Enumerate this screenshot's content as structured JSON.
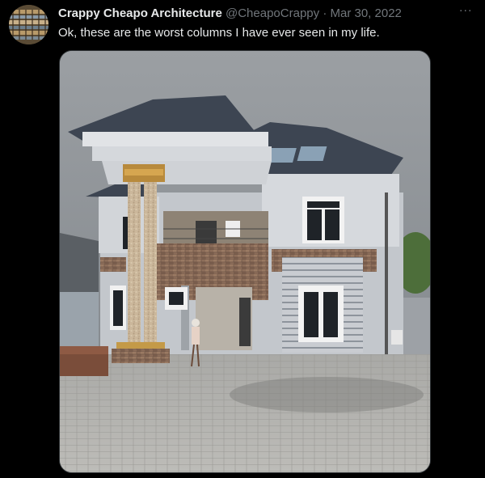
{
  "tweet": {
    "author_name": "Crappy Cheapo Architecture",
    "handle": "@CheapoCrappy",
    "separator": "·",
    "date": "Mar 30, 2022",
    "text": "Ok, these are the worst columns I have ever seen in my life.",
    "more_icon_text": "···"
  },
  "colors": {
    "background": "#000000",
    "primary_text": "#e7e9ea",
    "secondary_text": "#71767b"
  },
  "icons": {
    "more": "more-horizontal-icon",
    "avatar": "avatar-image"
  }
}
